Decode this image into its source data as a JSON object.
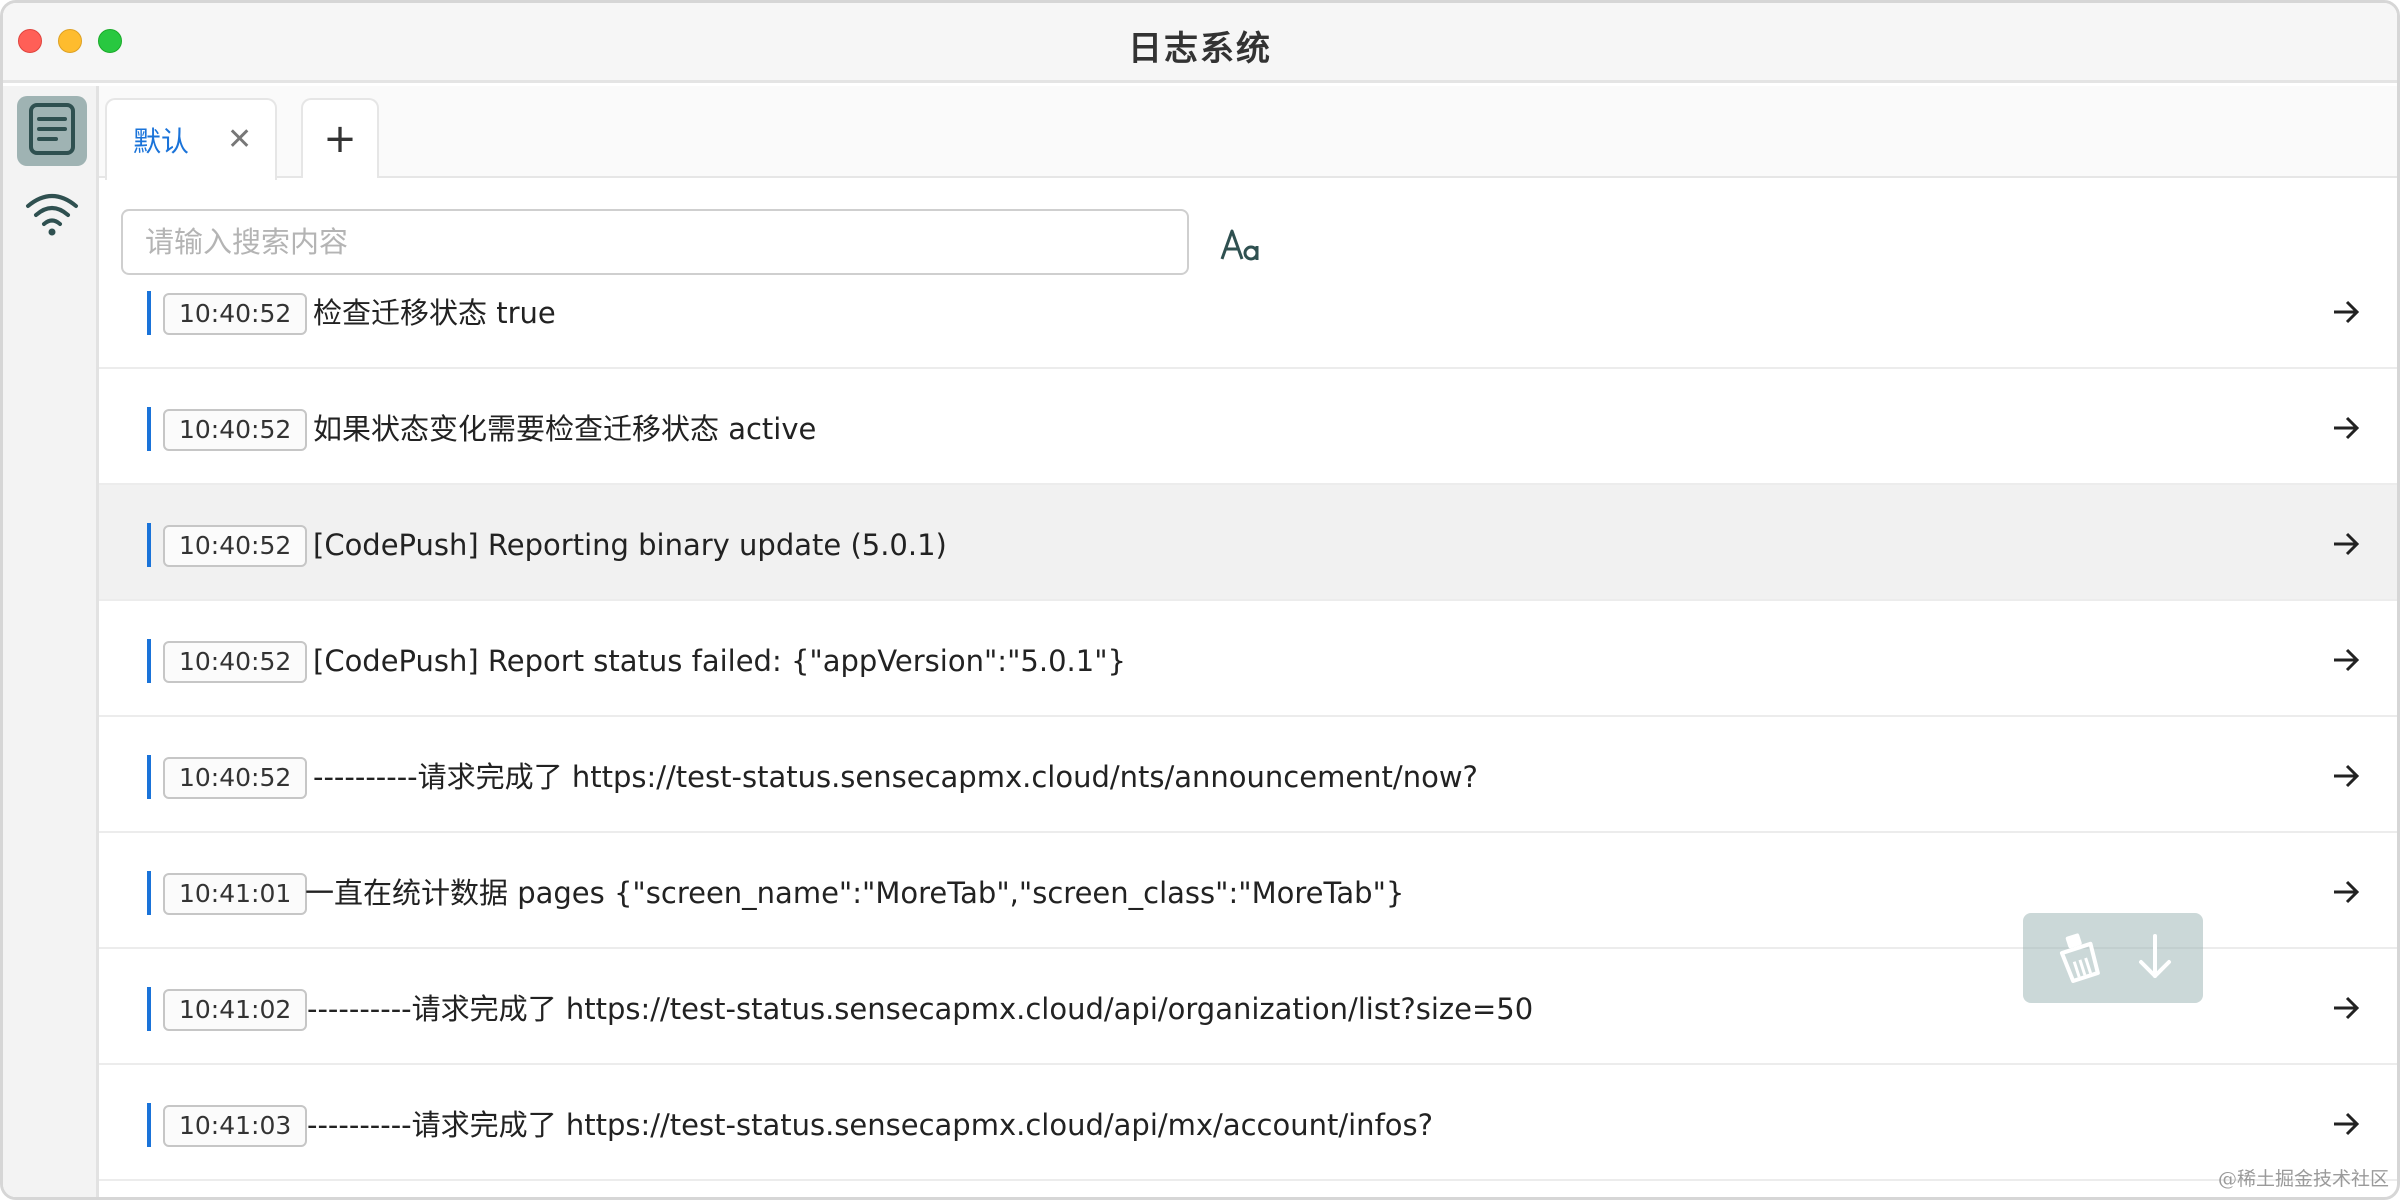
{
  "window": {
    "title": "日志系统"
  },
  "siderail": {
    "items": [
      {
        "icon": "log-list-icon",
        "active": true
      },
      {
        "icon": "wifi-icon",
        "active": false
      }
    ]
  },
  "tabs": {
    "items": [
      {
        "label": "默认",
        "close_glyph": "✕"
      }
    ],
    "add_glyph": "+"
  },
  "search": {
    "placeholder": "请输入搜索内容",
    "value": ""
  },
  "logs": [
    {
      "time": "10:40:52",
      "message": "检查迁移状态 true"
    },
    {
      "time": "10:40:52",
      "message": "如果状态变化需要检查迁移状态 active"
    },
    {
      "time": "10:40:52",
      "message": "[CodePush] Reporting binary update (5.0.1)"
    },
    {
      "time": "10:40:52",
      "message": "[CodePush] Report status failed: {\"appVersion\":\"5.0.1\"}"
    },
    {
      "time": "10:40:52",
      "message": "----------请求完成了 https://test-status.sensecapmx.cloud/nts/announcement/now?"
    },
    {
      "time": "10:41:01",
      "message": "一直在统计数据 pages {\"screen_name\":\"MoreTab\",\"screen_class\":\"MoreTab\"}"
    },
    {
      "time": "10:41:02",
      "message": "----------请求完成了 https://test-status.sensecapmx.cloud/api/organization/list?size=50"
    },
    {
      "time": "10:41:03",
      "message": "----------请求完成了 https://test-status.sensecapmx.cloud/api/mx/account/infos?"
    }
  ],
  "selected_log_index": 2,
  "colors": {
    "accent": "#1a73d9",
    "rail_active": "#9fb3b3",
    "icon_dark": "#2f5050"
  },
  "watermark": "@稀土掘金技术社区"
}
